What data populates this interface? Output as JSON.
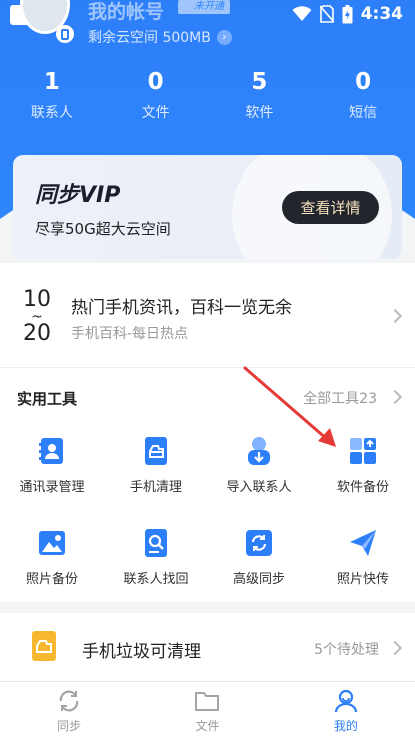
{
  "status_bar": {
    "time": "4:34"
  },
  "profile": {
    "account_name": "我的帐号",
    "vip_tag": "未开通",
    "cloud_space": "剩余云空间 500MB"
  },
  "stats": [
    {
      "value": "1",
      "label": "联系人"
    },
    {
      "value": "0",
      "label": "文件"
    },
    {
      "value": "5",
      "label": "软件"
    },
    {
      "value": "0",
      "label": "短信"
    }
  ],
  "vip_banner": {
    "title": "同步VIP",
    "subtitle": "尽享50G超大云空间",
    "button": "查看详情"
  },
  "news": {
    "date_top": "10",
    "date_sep": "~",
    "date_bottom": "20",
    "title": "热门手机资讯，百科一览无余",
    "subtitle": "手机百科-每日热点"
  },
  "tools": {
    "heading": "实用工具",
    "all_tools": "全部工具23",
    "items": [
      {
        "label": "通讯录管理",
        "icon": "contacts-book-icon"
      },
      {
        "label": "手机清理",
        "icon": "phone-clean-icon"
      },
      {
        "label": "导入联系人",
        "icon": "import-contact-icon"
      },
      {
        "label": "软件备份",
        "icon": "app-backup-icon"
      },
      {
        "label": "照片备份",
        "icon": "photo-backup-icon"
      },
      {
        "label": "联系人找回",
        "icon": "contact-recover-icon"
      },
      {
        "label": "高级同步",
        "icon": "advanced-sync-icon"
      },
      {
        "label": "照片快传",
        "icon": "photo-send-icon"
      }
    ]
  },
  "junk": {
    "title": "手机垃圾可清理",
    "count": "5个待处理"
  },
  "tabs": [
    {
      "label": "同步",
      "active": false
    },
    {
      "label": "文件",
      "active": false
    },
    {
      "label": "我的",
      "active": true
    }
  ],
  "colors": {
    "brand": "#2d7ff9",
    "annotation_arrow": "#e53935"
  }
}
